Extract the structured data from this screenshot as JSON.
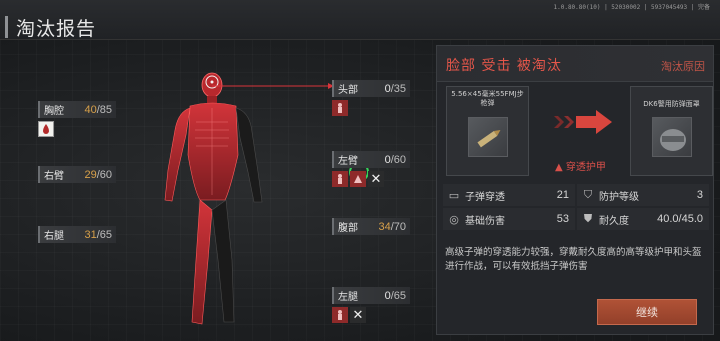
{
  "header": {
    "title": "淘汰报告",
    "version": "1.0.80.80(10) | 52030002 | 5937045493 | 完备"
  },
  "body_parts": {
    "chest": {
      "name": "胸腔",
      "current": "40",
      "max": "/85",
      "state": "warn",
      "icons": [
        "bleed-icon"
      ]
    },
    "left_arm": {
      "name": "右臂",
      "current": "29",
      "max": "/60",
      "state": "warn",
      "icons": []
    },
    "left_leg": {
      "name": "右腿",
      "current": "31",
      "max": "/65",
      "state": "warn",
      "icons": []
    },
    "head": {
      "name": "头部",
      "current": "0",
      "max": "/35",
      "state": "dead",
      "icons": [
        "bleed-icon"
      ]
    },
    "right_arm": {
      "name": "左臂",
      "current": "0",
      "max": "/60",
      "state": "dead",
      "icons": [
        "bleed-icon",
        "fracture-icon",
        "destroyed-icon"
      ]
    },
    "stomach": {
      "name": "腹部",
      "current": "34",
      "max": "/70",
      "state": "warn",
      "icons": []
    },
    "right_leg": {
      "name": "左腿",
      "current": "0",
      "max": "/65",
      "state": "dead",
      "icons": [
        "bleed-icon",
        "destroyed-icon"
      ]
    }
  },
  "report": {
    "death_title": "脸部  受击  被淘汰",
    "reason_link": "淘汰原因",
    "ammo_name": "5.56×45毫米55FMJ步枪弹",
    "armor_name": "DK6警用防弹面罩",
    "penetration_label": "穿透护甲",
    "stats": [
      {
        "icon": "bullet-icon",
        "label": "子弹穿透",
        "value": "21"
      },
      {
        "icon": "shield-icon",
        "label": "防护等级",
        "value": "3"
      },
      {
        "icon": "target-icon",
        "label": "基础伤害",
        "value": "53"
      },
      {
        "icon": "armor-icon",
        "label": "耐久度",
        "value": "40.0/45.0"
      }
    ],
    "description": "高级子弹的穿透能力较强，穿戴耐久度高的高等级护甲和头盔进行作战，可以有效抵挡子弹伤害",
    "continue_label": "继续"
  },
  "colors": {
    "accent": "#e4564a",
    "warn": "#d7a04a",
    "button": "#a34a31"
  }
}
